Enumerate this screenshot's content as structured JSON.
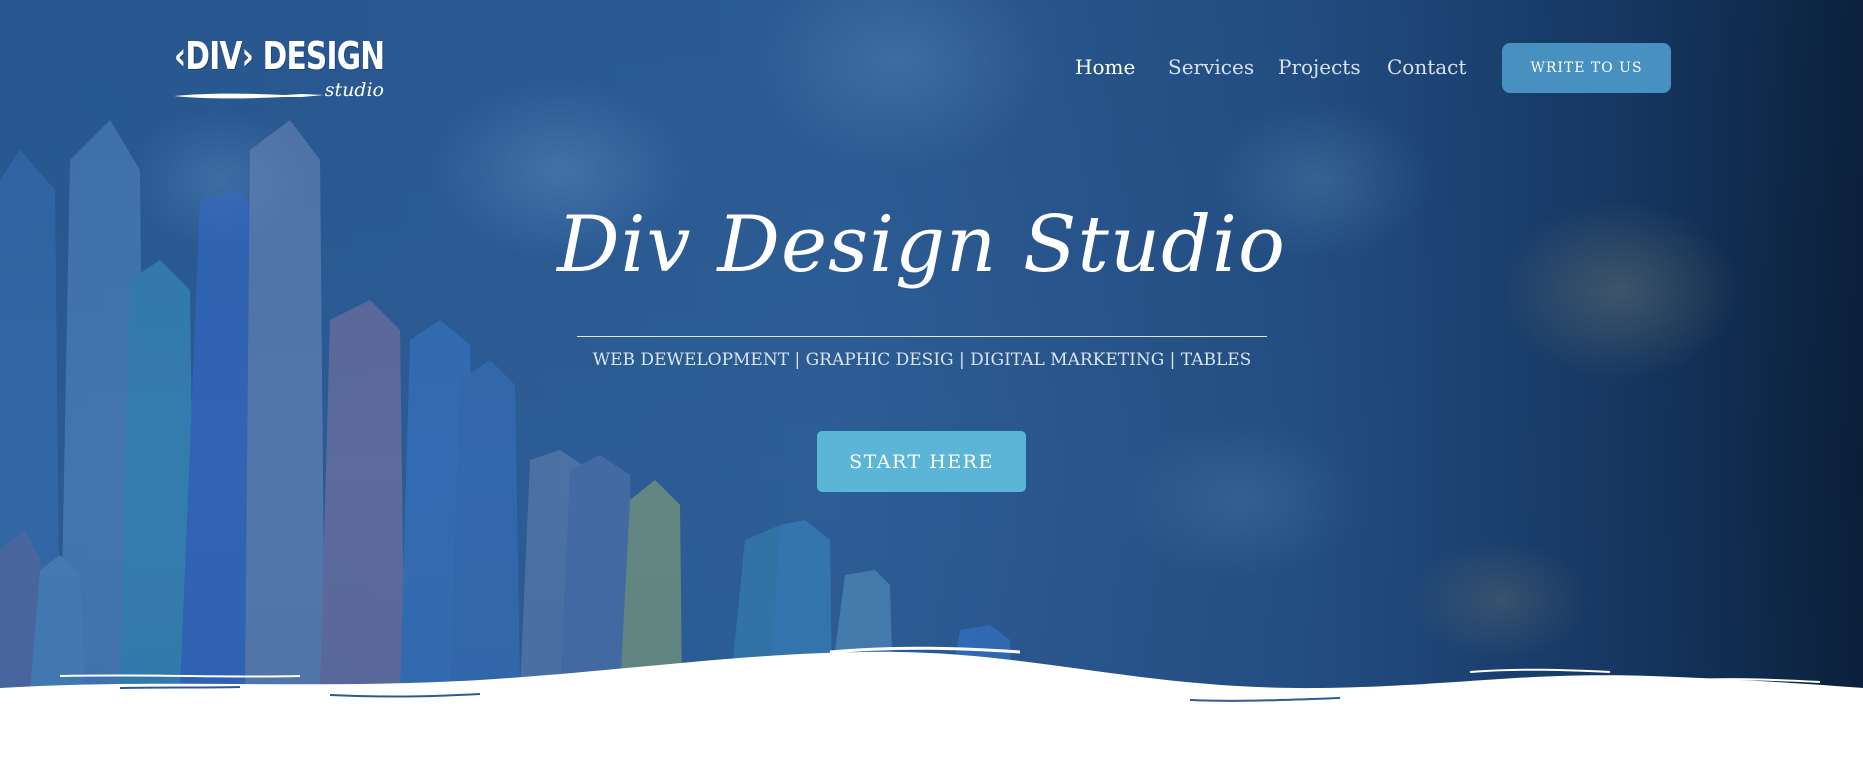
{
  "logo": {
    "main_text": "‹DIV› DESIGN",
    "sub_text": "studio"
  },
  "nav": {
    "items": [
      {
        "label": "Home",
        "active": true
      },
      {
        "label": "Services",
        "active": false
      },
      {
        "label": "Projects",
        "active": false
      },
      {
        "label": "Contact",
        "active": false
      }
    ]
  },
  "cta_header": {
    "label": "WRITE TO US"
  },
  "hero": {
    "title": "Div Design Studio",
    "subtitle": "WEB DEWELOPMENT  |  GRAPHIC DESIG  | DIGITAL MARKETING  |  TABLES",
    "button_label": "START HERE"
  },
  "colors": {
    "background_start": "#2b5b95",
    "background_end": "#0a1d35",
    "write_button": "#4790bf",
    "start_button": "#5bb5d7",
    "text": "#ffffff"
  }
}
